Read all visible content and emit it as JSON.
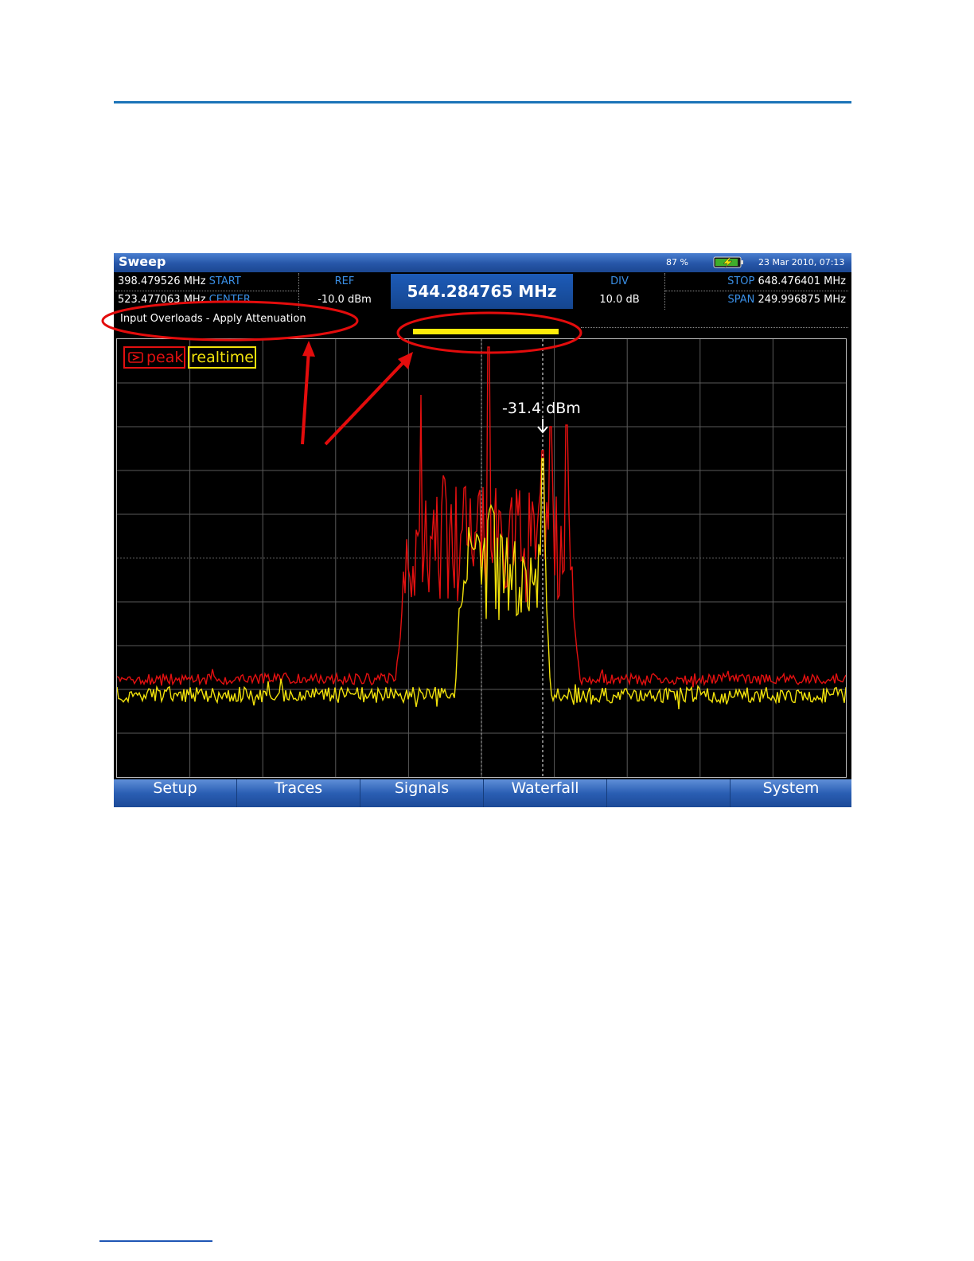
{
  "titlebar": {
    "title": "Sweep",
    "battery_percent": "87 %",
    "datetime": "23 Mar 2010, 07:13"
  },
  "params": {
    "start": {
      "value": "398.479526 MHz",
      "label": "START"
    },
    "center": {
      "value": "523.477063 MHz",
      "label": "CENTER"
    },
    "ref": {
      "label": "REF",
      "value": "-10.0 dBm"
    },
    "center_freq_display": "544.284765 MHz",
    "div": {
      "label": "DIV",
      "value": "10.0 dB"
    },
    "stop": {
      "label": "STOP",
      "value": "648.476401 MHz"
    },
    "span": {
      "label": "SPAN",
      "value": "249.996875 MHz"
    }
  },
  "status": {
    "message": "Input Overloads - Apply Attenuation"
  },
  "legend": {
    "peak": "peak",
    "realtime": "realtime"
  },
  "marker": {
    "readout": "-31.4 dBm"
  },
  "softkeys": [
    "Setup",
    "Traces",
    "Signals",
    "Waterfall",
    "",
    "System"
  ],
  "colors": {
    "peak_trace": "#e31010",
    "realtime_trace": "#f2e20b",
    "title_blue": "#2656a8",
    "annotation_red": "#e30c0c"
  }
}
